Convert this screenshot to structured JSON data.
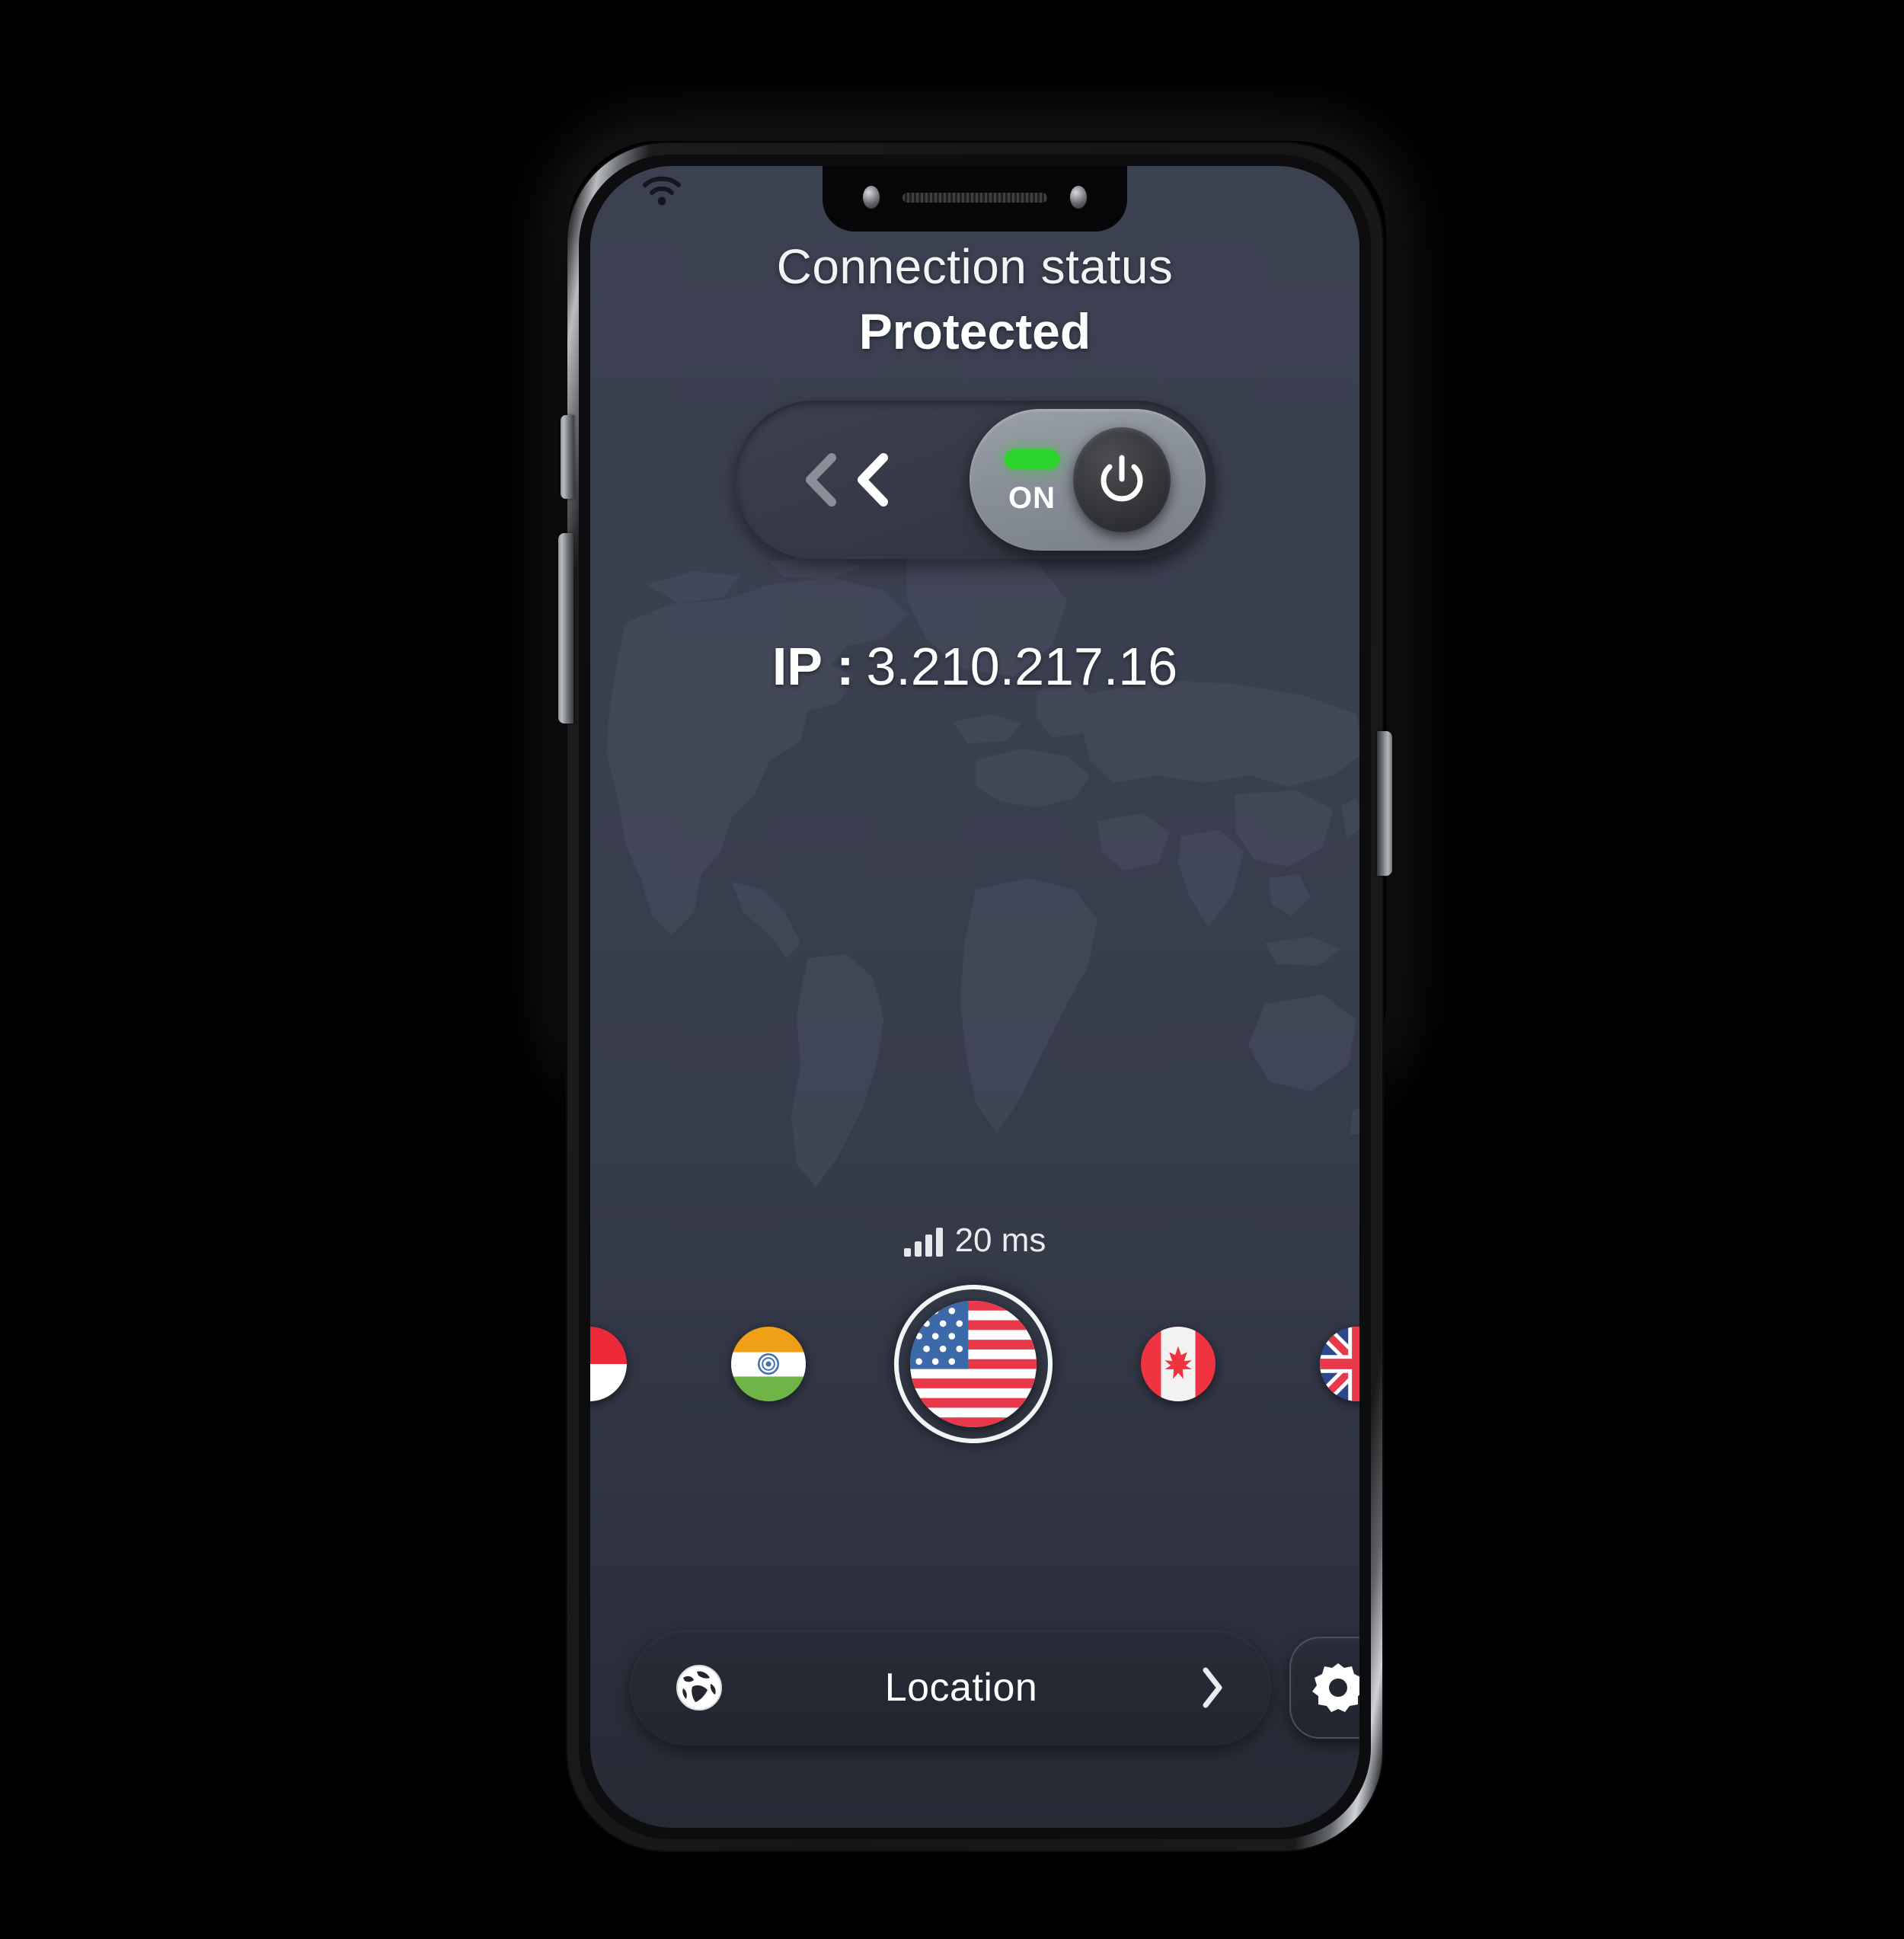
{
  "app": {
    "status_label": "Connection status",
    "status_value": "Protected",
    "toggle": {
      "state_text": "ON",
      "led_color": "#2bd42b",
      "collapse_icon": "double-chevron-left-icon",
      "power_icon": "power-icon"
    },
    "ip": {
      "label": "IP :",
      "value": "3.210.217.16"
    },
    "ping": {
      "icon": "signal-bars-icon",
      "text": "20 ms"
    },
    "flags": [
      {
        "name": "Singapore",
        "code": "SG",
        "selected": false,
        "position": "edge-left"
      },
      {
        "name": "India",
        "code": "IN",
        "selected": false,
        "position": "inner"
      },
      {
        "name": "United States",
        "code": "US",
        "selected": true,
        "position": "center"
      },
      {
        "name": "Canada",
        "code": "CA",
        "selected": false,
        "position": "inner"
      },
      {
        "name": "United Kingdom",
        "code": "GB",
        "selected": false,
        "position": "edge-right"
      }
    ],
    "bottom": {
      "globe_icon": "globe-icon",
      "location_label": "Location",
      "chevron_icon": "chevron-right-icon",
      "settings_icon": "gear-icon"
    },
    "status_bar": {
      "wifi_icon": "wifi-icon"
    },
    "colors": {
      "screen_background_top": "#3c4152",
      "screen_background_bottom": "#262a35",
      "map_silhouette": "#474c5e",
      "accent_green": "#2bd42b",
      "text_primary": "#ffffff",
      "toggle_knob": "#8a9099"
    }
  }
}
